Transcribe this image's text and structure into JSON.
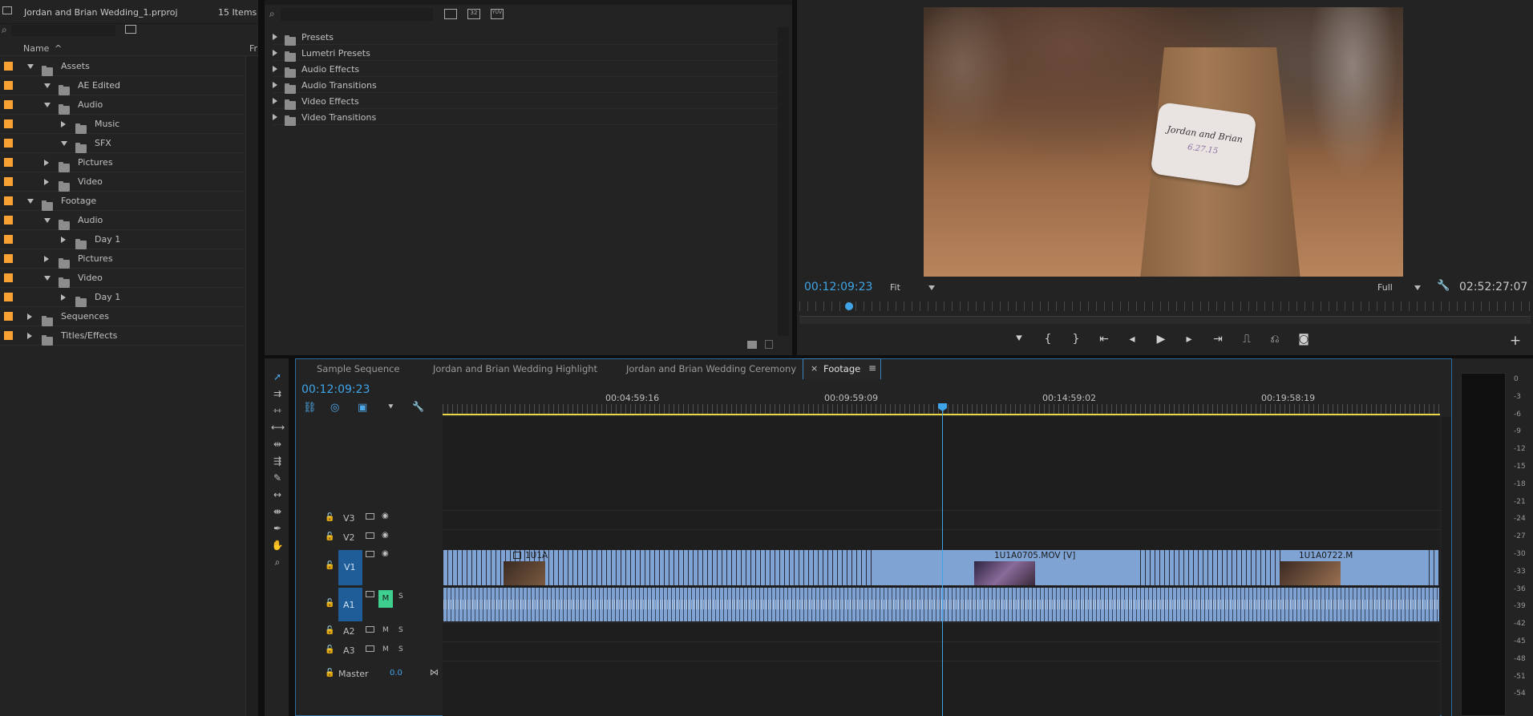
{
  "project": {
    "title": "Jordan and Brian Wedding_1.prproj",
    "item_count": "15 Items",
    "col_name": "Name",
    "col_fr": "Fr",
    "tree": [
      {
        "label": "Assets",
        "level": 0,
        "expanded": true
      },
      {
        "label": "AE Edited",
        "level": 1,
        "expanded": true
      },
      {
        "label": "Audio",
        "level": 1,
        "expanded": true
      },
      {
        "label": "Music",
        "level": 2,
        "expanded": false
      },
      {
        "label": "SFX",
        "level": 2,
        "expanded": true
      },
      {
        "label": "Pictures",
        "level": 1,
        "expanded": false
      },
      {
        "label": "Video",
        "level": 1,
        "expanded": false
      },
      {
        "label": "Footage",
        "level": 0,
        "expanded": true
      },
      {
        "label": "Audio",
        "level": 1,
        "expanded": true
      },
      {
        "label": "Day 1",
        "level": 2,
        "expanded": false
      },
      {
        "label": "Pictures",
        "level": 1,
        "expanded": false
      },
      {
        "label": "Video",
        "level": 1,
        "expanded": true
      },
      {
        "label": "Day 1",
        "level": 2,
        "expanded": false
      },
      {
        "label": "Sequences",
        "level": 0,
        "expanded": false
      },
      {
        "label": "Titles/Effects",
        "level": 0,
        "expanded": false
      }
    ]
  },
  "effects": {
    "items": [
      "Presets",
      "Lumetri Presets",
      "Audio Effects",
      "Audio Transitions",
      "Video Effects",
      "Video Transitions"
    ]
  },
  "monitor": {
    "timecode": "00:12:09:23",
    "fit": "Fit",
    "quality": "Full",
    "duration": "02:52:27:07",
    "tag_line1": "Jordan and Brian",
    "tag_line2": "6.27.15"
  },
  "timeline": {
    "tabs": [
      "Sample Sequence",
      "Jordan and Brian Wedding Highlight",
      "Jordan and Brian Wedding Ceremony",
      "Footage"
    ],
    "active_tab": "Footage",
    "timecode": "00:12:09:23",
    "ruler": [
      "00:04:59:16",
      "00:09:59:09",
      "00:14:59:02",
      "00:19:58:19"
    ],
    "tracks": {
      "v3": "V3",
      "v2": "V2",
      "v1": "V1",
      "a1": "A1",
      "a2": "A2",
      "a3": "A3",
      "master": "Master",
      "master_val": "0.0",
      "m": "M",
      "s": "S"
    },
    "clips": [
      "1U1A",
      "1U1A0705.MOV [V]",
      "1U1A0722.M"
    ]
  },
  "meter": {
    "labels": [
      "0",
      "-3",
      "-6",
      "-9",
      "-12",
      "-15",
      "-18",
      "-21",
      "-24",
      "-27",
      "-30",
      "-33",
      "-36",
      "-39",
      "-42",
      "-45",
      "-48",
      "-51",
      "-54"
    ]
  },
  "colors": {
    "accent": "#3fa5e8",
    "label": "#f7a232",
    "clip": "#7fa3d3",
    "playhead": "#3fa5e8"
  }
}
